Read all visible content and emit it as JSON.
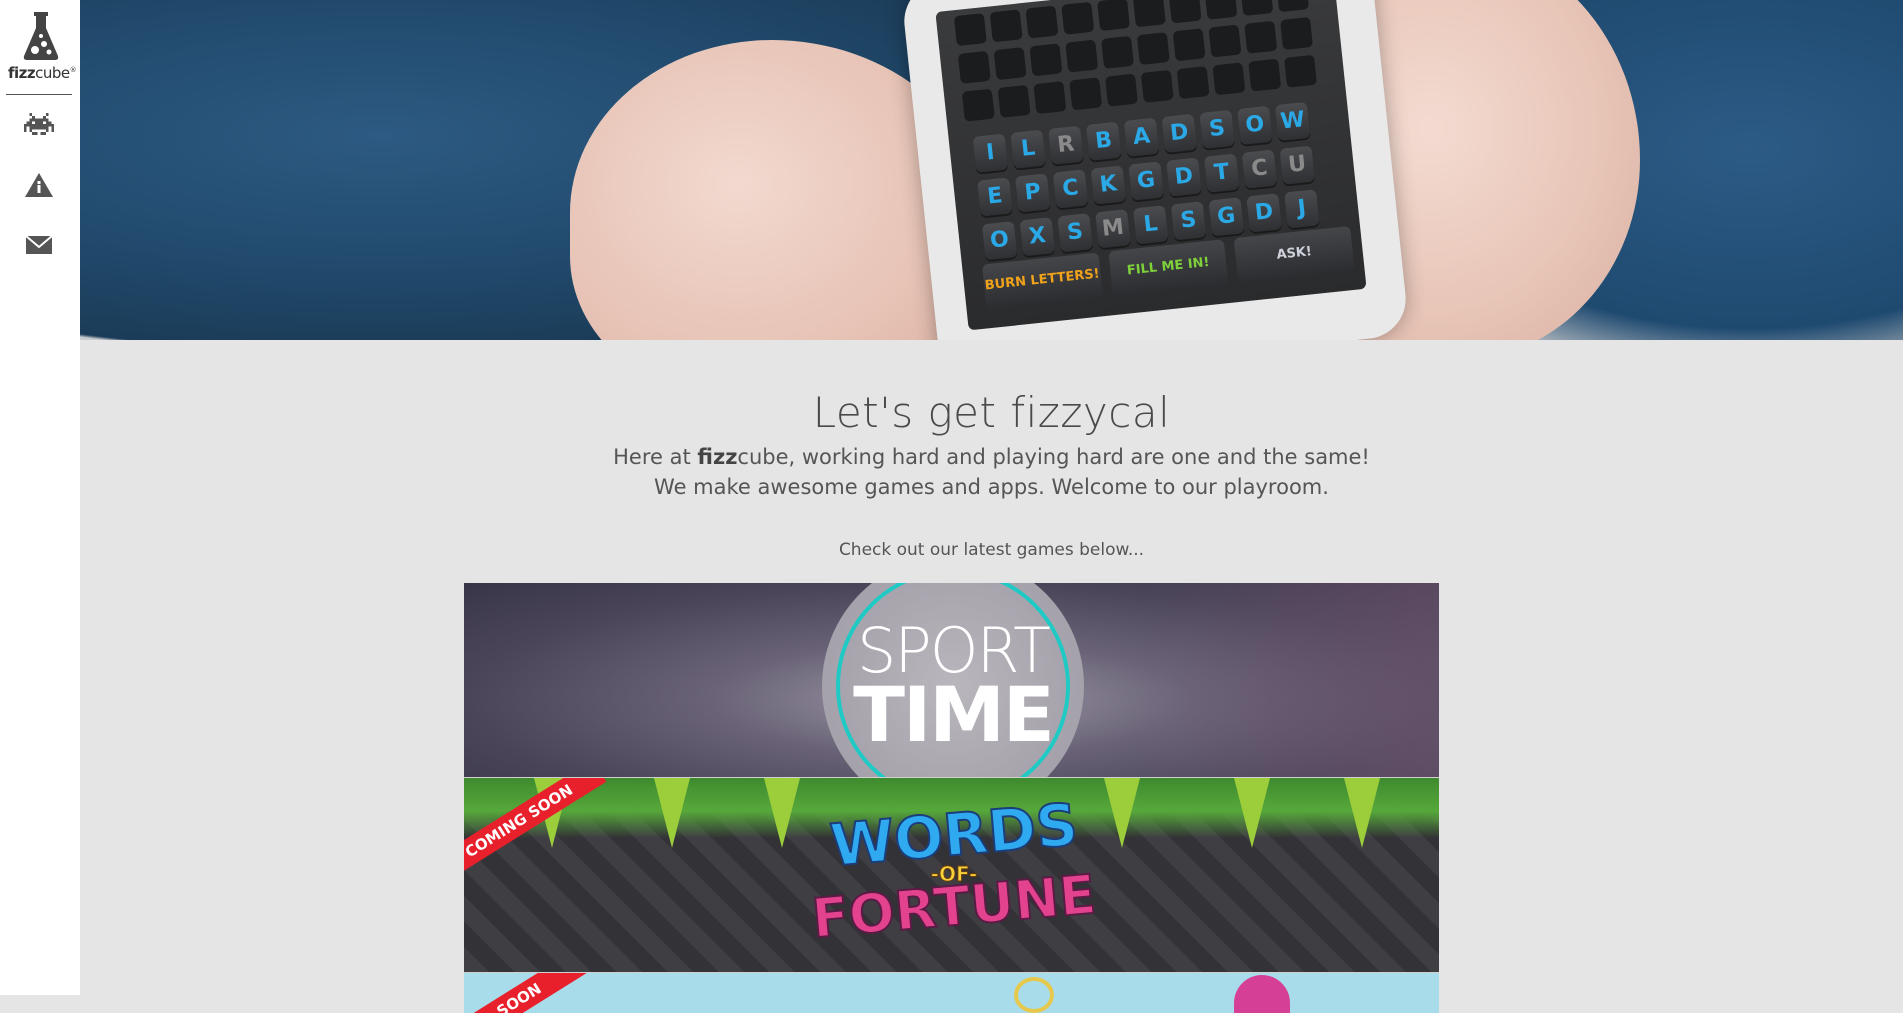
{
  "brand": {
    "name_bold": "fizz",
    "name_light": "cube",
    "mark": "®"
  },
  "nav": [
    {
      "id": "games",
      "icon": "space-invader-icon"
    },
    {
      "id": "about",
      "icon": "info-warning-icon"
    },
    {
      "id": "contact",
      "icon": "envelope-icon"
    }
  ],
  "hero": {
    "phone_letter_rows": [
      [
        "I",
        "L",
        "R",
        "B",
        "A",
        "D",
        "S",
        "O",
        "W"
      ],
      [
        "E",
        "P",
        "C",
        "K",
        "G",
        "D",
        "T",
        "C",
        "U"
      ],
      [
        "O",
        "X",
        "S",
        "M",
        "L",
        "S",
        "G",
        "D",
        "J"
      ]
    ],
    "powerups": [
      "BURN LETTERS!",
      "FILL ME IN!",
      "ASK!"
    ]
  },
  "intro": {
    "title": "Let's get fizzycal",
    "line1_prefix": "Here at ",
    "line1_bold": "fizz",
    "line1_suffix": "cube, working hard and playing hard are one and the same!",
    "line2": "We make awesome games and apps. Welcome to our playroom.",
    "cta": "Check out our latest games below..."
  },
  "games": [
    {
      "title_top": "SPORT",
      "title_bottom": "TIME",
      "accent": "#1fc9c4"
    },
    {
      "ribbon": "COMING SOON",
      "title_top": "WORDS",
      "title_mid": "-OF-",
      "title_bottom": "FORTUNE"
    },
    {
      "ribbon": "SOON"
    }
  ]
}
